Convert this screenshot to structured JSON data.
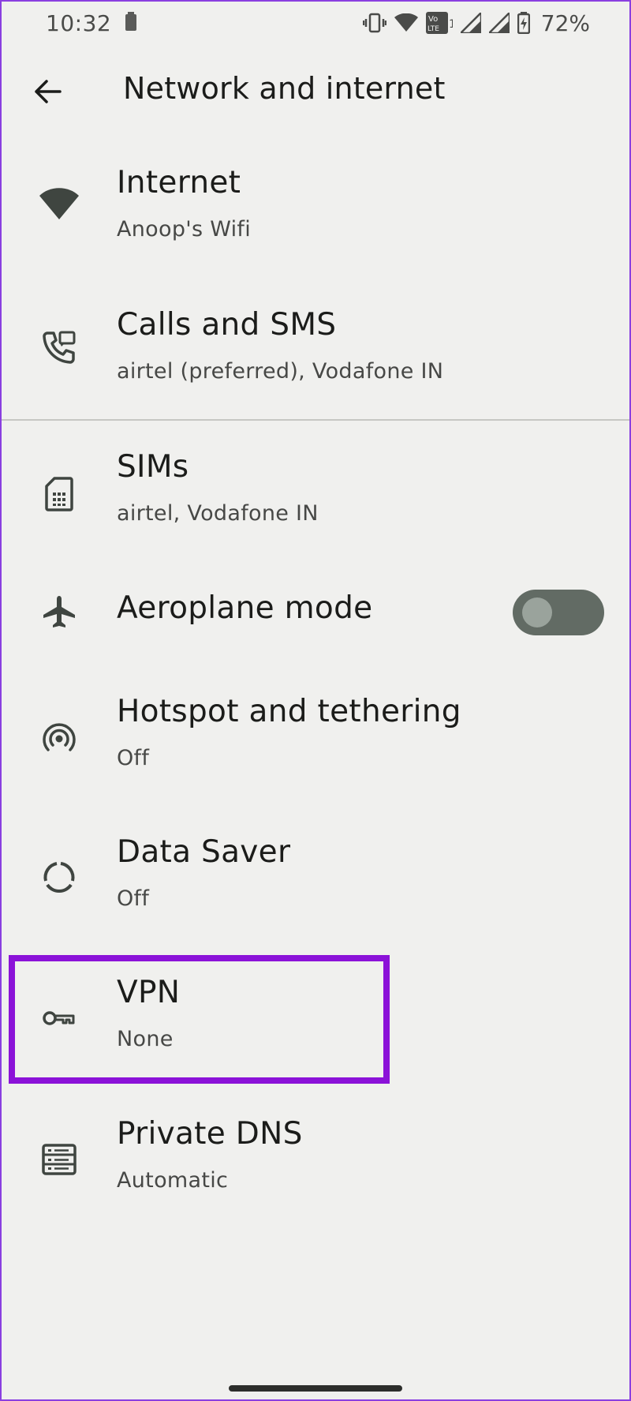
{
  "status_bar": {
    "time": "10:32",
    "battery_percent": "72%",
    "icons": [
      "battery-small-icon",
      "vibrate-icon",
      "wifi-icon",
      "volte-icon",
      "signal-icon",
      "signal-icon",
      "battery-charging-icon"
    ]
  },
  "app_bar": {
    "title": "Network and internet",
    "back_icon": "arrow-back-icon"
  },
  "items": [
    {
      "title": "Internet",
      "subtitle": "Anoop's Wifi",
      "icon": "wifi-icon"
    },
    {
      "title": "Calls and SMS",
      "subtitle": "airtel (preferred), Vodafone IN",
      "icon": "phone-icon"
    },
    {
      "title": "SIMs",
      "subtitle": "airtel, Vodafone IN",
      "icon": "sim-card-icon"
    },
    {
      "title": "Aeroplane mode",
      "subtitle": "",
      "icon": "airplane-icon",
      "toggle_on": false
    },
    {
      "title": "Hotspot and tethering",
      "subtitle": "Off",
      "icon": "hotspot-icon"
    },
    {
      "title": "Data Saver",
      "subtitle": "Off",
      "icon": "data-saver-icon"
    },
    {
      "title": "VPN",
      "subtitle": "None",
      "icon": "key-icon"
    },
    {
      "title": "Private DNS",
      "subtitle": "Automatic",
      "icon": "dns-icon"
    }
  ],
  "colors": {
    "background": "#f0f0ee",
    "highlight": "#8b12d8",
    "toggle_track": "#626b64",
    "icon": "#3f4540"
  }
}
